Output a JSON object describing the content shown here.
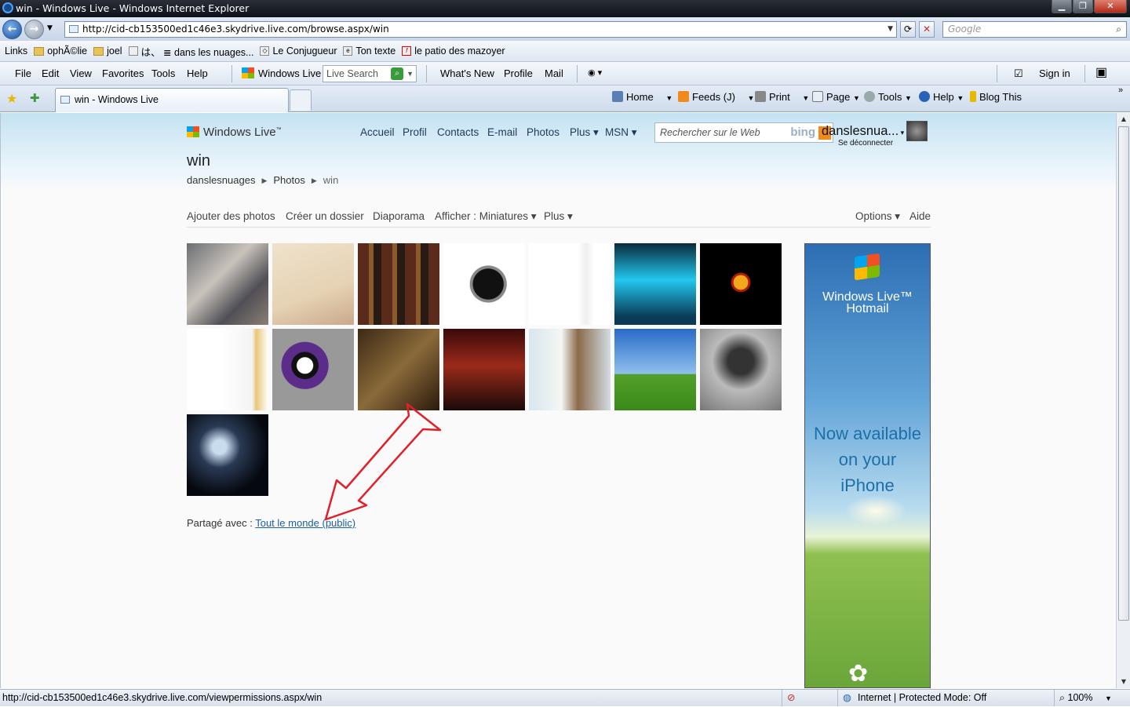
{
  "window": {
    "title": "win - Windows Live - Windows Internet Explorer"
  },
  "address": {
    "url": "http://cid-cb153500ed1c46e3.skydrive.live.com/browse.aspx/win",
    "search_placeholder": "Google"
  },
  "links_bar": [
    "Links",
    "ophÃ©lie",
    "joel",
    "は、 ≣ dans les nuages...",
    "Le Conjugueur",
    "Ton texte",
    "le patio des mazoyer"
  ],
  "menu": {
    "items": [
      "File",
      "Edit",
      "View",
      "Favorites",
      "Tools",
      "Help"
    ],
    "windows_live": "Windows Live",
    "live_search": "Live Search",
    "whats_new": "What's New",
    "profile": "Profile",
    "mail": "Mail",
    "sign_in": "Sign in"
  },
  "tab": {
    "label": "win - Windows Live"
  },
  "commands": {
    "home": "Home",
    "feeds": "Feeds (J)",
    "print": "Print",
    "page": "Page",
    "tools": "Tools",
    "help": "Help",
    "blog": "Blog This"
  },
  "site": {
    "logo": "Windows Live",
    "nav": [
      "Accueil",
      "Profil",
      "Contacts",
      "E-mail",
      "Photos",
      "Plus ▾",
      "MSN ▾"
    ],
    "search_placeholder": "Rechercher sur le Web",
    "bing": "bing",
    "username": "danslesnua...",
    "logout": "Se déconnecter",
    "page_title": "win",
    "breadcrumb": [
      "danslesnuages",
      "Photos",
      "win"
    ]
  },
  "toolbar": {
    "add_photos": "Ajouter des photos",
    "new_folder": "Créer un dossier",
    "slideshow": "Diaporama",
    "view": "Afficher : Miniatures ▾",
    "more": "Plus ▾",
    "options": "Options ▾",
    "help": "Aide"
  },
  "photos": [
    {
      "name": "photo-1",
      "bg": "linear-gradient(135deg,#6b6e74,#c9c3bb 40%,#504f55 70%,#8a7f75)"
    },
    {
      "name": "photo-2",
      "bg": "linear-gradient(160deg,#efe2cc,#e6d2b4 60%,#c9a98a)"
    },
    {
      "name": "photo-3",
      "bg": "repeating-linear-gradient(90deg,#5a2a1a 0 14px,#8a5a2a 14px 20px,#2a1a14 20px 30px)"
    },
    {
      "name": "photo-4",
      "bg": "radial-gradient(circle at 55% 50%,#111 0 25%,#888 26% 30%,#fff 31%)"
    },
    {
      "name": "photo-5",
      "bg": "linear-gradient(90deg,#fff 60%,#eee 70%,#fff 80%)"
    },
    {
      "name": "photo-6",
      "bg": "linear-gradient(#0a2a3a,#22c8f0 45%,#0a3a55 90%)"
    },
    {
      "name": "photo-7",
      "bg": "radial-gradient(circle at 50% 48%,#f2a81c 0 12%,#b21a0a 13% 16%,#000 17%)"
    },
    {
      "name": "photo-8",
      "bg": "linear-gradient(90deg,#fff 40%,#f4f4f4 80%,#e9c77a 85%,#fff)"
    },
    {
      "name": "photo-9",
      "bg": "radial-gradient(circle at 40% 45%,#fff 0 12%,#111 13% 20%,#5b2c8a 21% 35%,#999 36%)"
    },
    {
      "name": "photo-10",
      "bg": "linear-gradient(135deg,#3b2a14,#8a6a3a 50%,#2a1a0c)"
    },
    {
      "name": "photo-11",
      "bg": "linear-gradient(#3a0a0a,#9a2a1a 45%,#1a0a0a)"
    },
    {
      "name": "photo-12",
      "bg": "linear-gradient(90deg,#d8e6ee,#f4f6f4 40%,#8a6a4a 60%,#d2dde4)"
    },
    {
      "name": "photo-13",
      "bg": "linear-gradient(#2a6ac8,#8ec0ec 55%,#52a02a 56%,#3a8a1a)"
    },
    {
      "name": "photo-14",
      "bg": "radial-gradient(circle at 50% 40%,#333 0 20%,#bbb 45%,#777)"
    },
    {
      "name": "photo-15",
      "bg": "radial-gradient(circle at 40% 40%,#c8dcee 0 10%,#2a3a55 30%,#05080e 70%)"
    }
  ],
  "shared": {
    "label": "Partagé avec : ",
    "link": "Tout le monde (public)"
  },
  "ad": {
    "brand_line1": "Windows Live™",
    "brand_line2": "Hotmail",
    "line1": "Now available",
    "line2": "on your",
    "line3": "iPhone"
  },
  "status": {
    "url": "http://cid-cb153500ed1c46e3.skydrive.live.com/viewpermissions.aspx/win",
    "zone": "Internet | Protected Mode: Off",
    "zoom": "100%"
  },
  "colors": {
    "link": "#1a5fa8",
    "arrow": "#e0202a"
  }
}
